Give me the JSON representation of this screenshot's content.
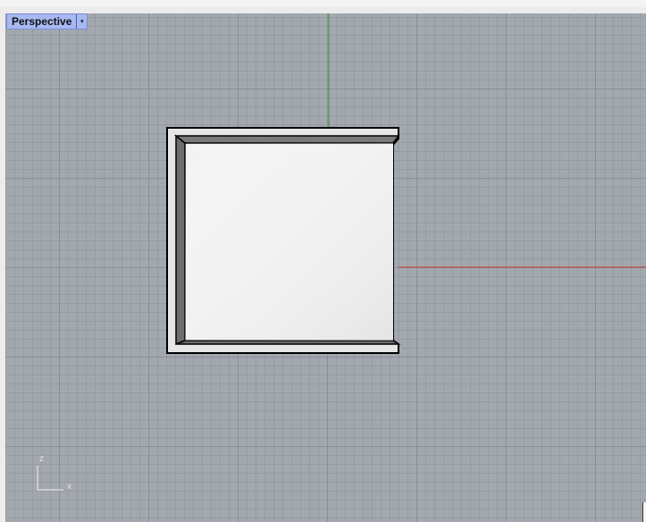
{
  "viewport": {
    "name": "Perspective",
    "menu_glyph": "▾"
  },
  "axis_widget": {
    "z_label": "z",
    "x_label": "x"
  },
  "colors": {
    "grid_background": "#a3a8ae",
    "x_axis": "#b94a48",
    "y_axis": "#3f9b3f",
    "object_fill": "#f1f1f1",
    "object_edge": "#000000",
    "tab_background": "#a8b8f2"
  },
  "icons": {
    "viewport_menu": "dropdown-arrow-icon",
    "axis_gizmo": "axis-gizmo-icon"
  }
}
